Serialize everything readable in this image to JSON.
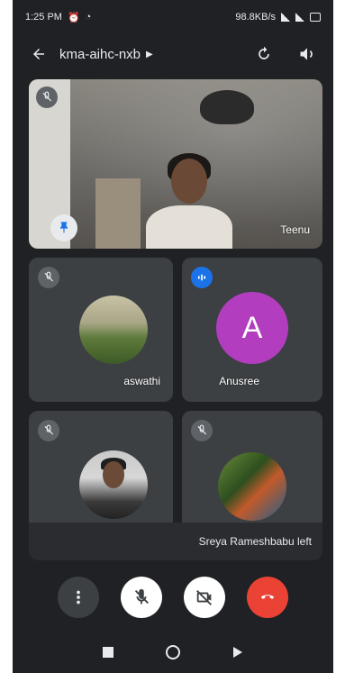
{
  "status_bar": {
    "time": "1:25 PM",
    "data_speed": "98.8KB/s"
  },
  "top_bar": {
    "meeting_code": "kma-aihc-nxb",
    "back_icon": "arrow-back-icon",
    "switch_camera_icon": "switch-camera-icon",
    "audio_output_icon": "speaker-icon"
  },
  "participants": {
    "main": {
      "name": "Teenu",
      "mic": "muted"
    },
    "tile_2_left": {
      "name": "aswathi",
      "mic": "muted"
    },
    "tile_2_right": {
      "name": "Anusree",
      "initial": "A",
      "mic": "speaking",
      "avatar_color": "#b23dbf"
    },
    "tile_3_left": {
      "name": "",
      "mic": "muted"
    },
    "tile_3_right": {
      "name": "",
      "mic": "muted"
    }
  },
  "caption": "Sreya Rameshbabu left",
  "controls": {
    "more_icon": "more-vert-icon",
    "mic_icon": "mic-off-icon",
    "camera_icon": "videocam-off-icon",
    "end_call_icon": "call-end-icon"
  },
  "colors": {
    "background": "#202124",
    "tile": "#3c4043",
    "accent_blue": "#1a73e8",
    "end_call_red": "#ea4335"
  }
}
